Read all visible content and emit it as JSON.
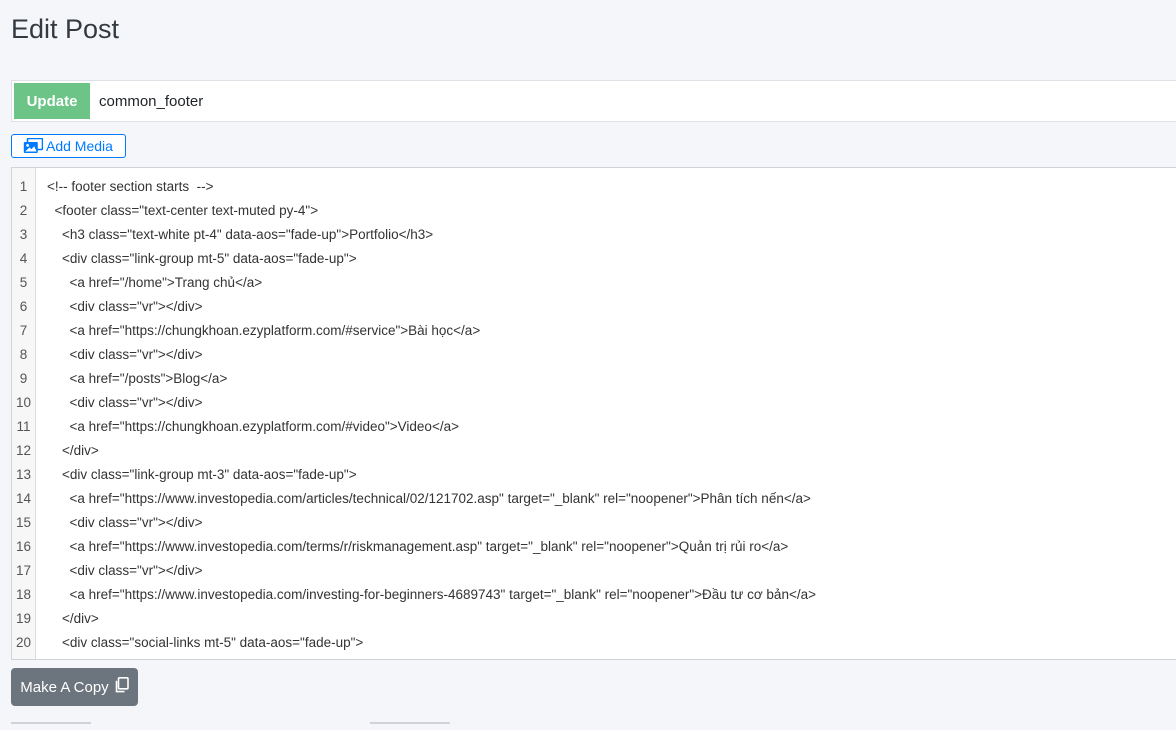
{
  "page": {
    "title": "Edit Post"
  },
  "form": {
    "update_label": "Update",
    "title_value": "common_footer",
    "add_media_label": "Add Media",
    "copy_label": "Make A Copy"
  },
  "editor": {
    "lines": [
      {
        "n": "1",
        "text": "<!-- footer section starts  -->"
      },
      {
        "n": "2",
        "text": "  <footer class=\"text-center text-muted py-4\">"
      },
      {
        "n": "3",
        "text": "    <h3 class=\"text-white pt-4\" data-aos=\"fade-up\">Portfolio</h3>"
      },
      {
        "n": "4",
        "text": "    <div class=\"link-group mt-5\" data-aos=\"fade-up\">"
      },
      {
        "n": "5",
        "text": "      <a href=\"/home\">Trang chủ</a>"
      },
      {
        "n": "6",
        "text": "      <div class=\"vr\"></div>"
      },
      {
        "n": "7",
        "text": "      <a href=\"https://chungkhoan.ezyplatform.com/#service\">Bài học</a>"
      },
      {
        "n": "8",
        "text": "      <div class=\"vr\"></div>"
      },
      {
        "n": "9",
        "text": "      <a href=\"/posts\">Blog</a>"
      },
      {
        "n": "10",
        "text": "      <div class=\"vr\"></div>"
      },
      {
        "n": "11",
        "text": "      <a href=\"https://chungkhoan.ezyplatform.com/#video\">Video</a>"
      },
      {
        "n": "12",
        "text": "    </div>"
      },
      {
        "n": "13",
        "text": "    <div class=\"link-group mt-3\" data-aos=\"fade-up\">"
      },
      {
        "n": "14",
        "text": "      <a href=\"https://www.investopedia.com/articles/technical/02/121702.asp\" target=\"_blank\" rel=\"noopener\">Phân tích nến</a>"
      },
      {
        "n": "15",
        "text": "      <div class=\"vr\"></div>"
      },
      {
        "n": "16",
        "text": "      <a href=\"https://www.investopedia.com/terms/r/riskmanagement.asp\" target=\"_blank\" rel=\"noopener\">Quản trị rủi ro</a>"
      },
      {
        "n": "17",
        "text": "      <div class=\"vr\"></div>"
      },
      {
        "n": "18",
        "text": "      <a href=\"https://www.investopedia.com/investing-for-beginners-4689743\" target=\"_blank\" rel=\"noopener\">Đầu tư cơ bản</a>"
      },
      {
        "n": "19",
        "text": "    </div>"
      },
      {
        "n": "20",
        "text": "    <div class=\"social-links mt-5\" data-aos=\"fade-up\">"
      }
    ]
  },
  "icons": {
    "add_media": "images-icon",
    "copy": "copy-icon"
  },
  "colors": {
    "update_button": "#6cc486",
    "add_media_accent": "#007bff",
    "copy_button": "#6c757d",
    "background": "#f4f6f9"
  }
}
